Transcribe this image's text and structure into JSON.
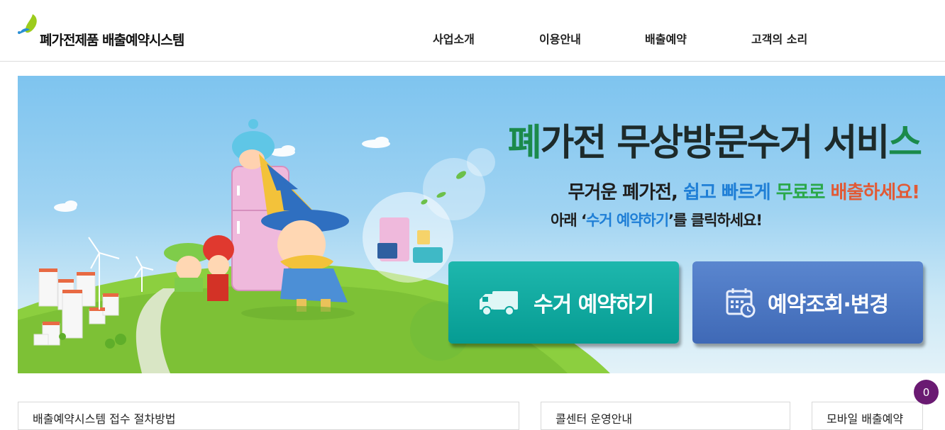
{
  "header": {
    "logo_text": "폐가전제품 배출예약시스템",
    "nav": [
      {
        "label": "사업소개"
      },
      {
        "label": "이용안내"
      },
      {
        "label": "배출예약"
      },
      {
        "label": "고객의 소리"
      }
    ]
  },
  "hero": {
    "headline": {
      "first": "폐",
      "middle": "가전 무상방문수거 서비",
      "last": "스"
    },
    "sub1": {
      "a": "무거운 ",
      "b": "폐가전",
      "c": ", ",
      "d": "쉽고 빠르게",
      "e": " ",
      "f": "무료로",
      "g": " ",
      "h": "배출하세요!"
    },
    "sub2": {
      "a": "아래 ‘",
      "b": "수거 예약하기",
      "c": "’를 클릭하세요!"
    },
    "buttons": {
      "collect_label": "수거 예약하기",
      "check_label": "예약조회·변경"
    }
  },
  "panels": [
    {
      "title": "배출예약시스템 접수 절차방법"
    },
    {
      "title": "콜센터 운영안내"
    },
    {
      "title": "모바일 배출예약"
    }
  ],
  "badge": {
    "count": "0"
  },
  "colors": {
    "collect_button": "#0aa59c",
    "check_button": "#4a74c0",
    "headline_accent": "#1b8a4b",
    "highlight_blue": "#1f7fd6",
    "highlight_green": "#2aa84a",
    "highlight_orange": "#e15a36",
    "badge": "#6a1a72"
  }
}
